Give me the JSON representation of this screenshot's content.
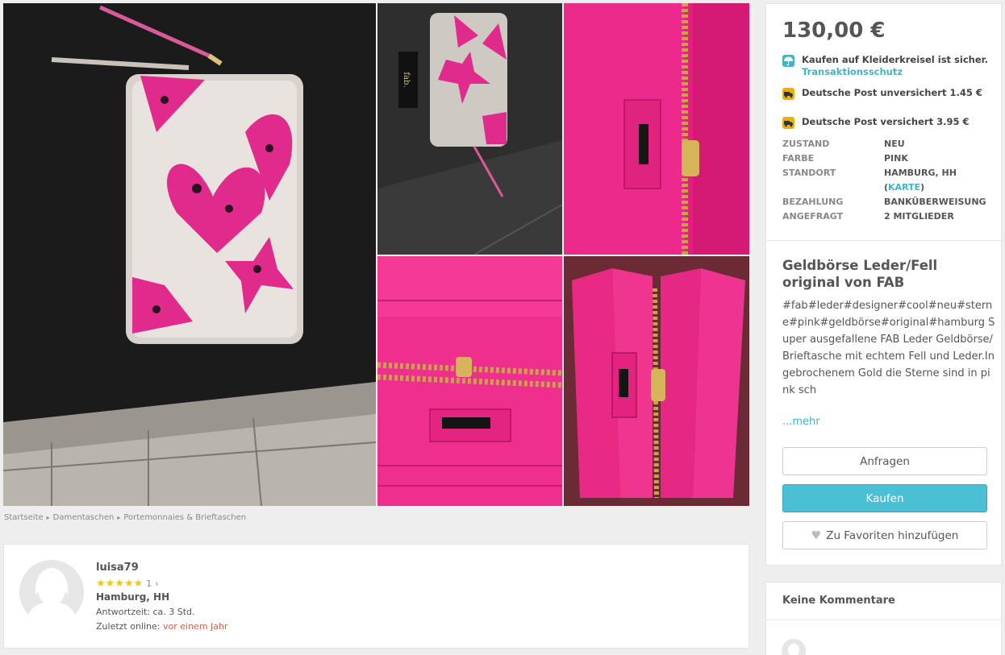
{
  "gallery": {
    "photo_1_logo": "fab.",
    "photo_2_logo": "fab."
  },
  "breadcrumb": {
    "items": [
      "Startseite",
      "Damentaschen",
      "Portemonnaies & Brieftaschen"
    ]
  },
  "seller": {
    "username": "luisa79",
    "stars": "★★★★★",
    "review_count": "1",
    "city": "Hamburg, HH",
    "response_time": "Antwortzeit: ca. 3 Std.",
    "last_online_label": "Zuletzt online:",
    "last_online_value": "vor einem Jahr"
  },
  "listing": {
    "price": "130,00 €",
    "protection_text": "Kaufen auf Kleiderkreisel ist sicher.",
    "protection_link": "Transaktionsschutz",
    "shipping": [
      {
        "label": "Deutsche Post unversichert 1.45 €"
      },
      {
        "label": "Deutsche Post versichert 3.95 €"
      }
    ],
    "attributes": {
      "condition_key": "ZUSTAND",
      "condition_value": "NEU",
      "color_key": "FARBE",
      "color_value": "PINK",
      "location_key": "STANDORT",
      "location_value": "HAMBURG, HH",
      "location_map_link": "KARTE",
      "payment_key": "BEZAHLUNG",
      "payment_value": "BANKÜBERWEISUNG",
      "requested_key": "ANGEFRAGT",
      "requested_value": "2 MITGLIEDER"
    },
    "title": "Geldbörse Leder/Fell original von FAB",
    "description": "#fab#leder#designer#cool#neu#sterne#pink#geldbörse#original#hamburg Super ausgefallene FAB Leder Geldbörse/Brieftasche mit echtem Fell und Leder.In gebrochenem Gold die Sterne sind in pink sch",
    "more_link": "...mehr",
    "ask_button": "Anfragen",
    "buy_button": "Kaufen",
    "favorite_button": "Zu Favoriten hinzufügen"
  },
  "comments": {
    "title": "Keine Kommentare"
  },
  "colors": {
    "accent_teal": "#4bbfd3",
    "link_teal": "#3fb5c6",
    "online_red": "#e05a47",
    "star_yellow": "#f5c518",
    "shipping_icon_yellow": "#e8b300"
  }
}
